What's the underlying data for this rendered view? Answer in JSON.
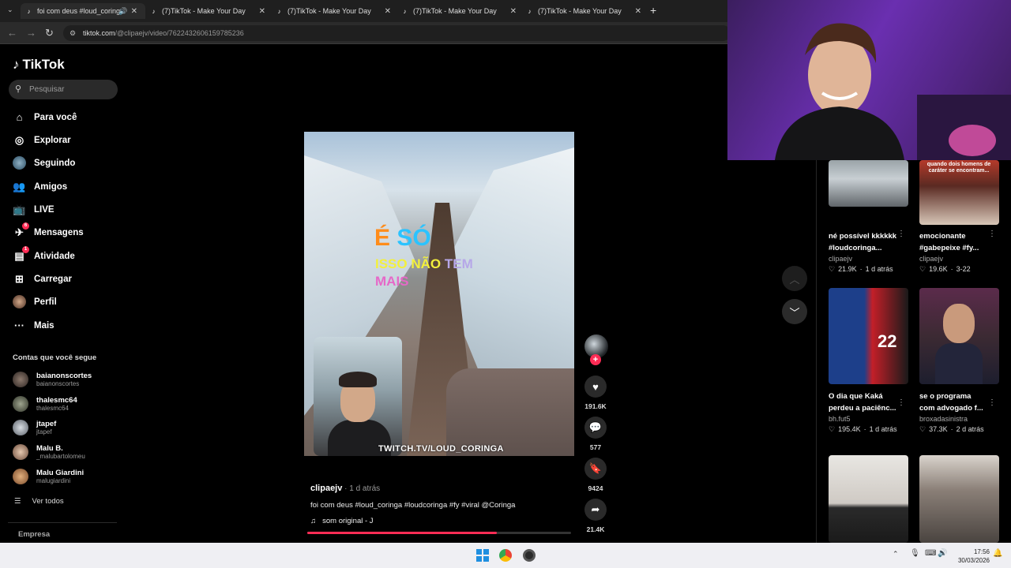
{
  "browser": {
    "tabs": [
      {
        "label": "foi com deus #loud_coringa",
        "active": true
      },
      {
        "label": "(7)TikTok - Make Your Day"
      },
      {
        "label": "(7)TikTok - Make Your Day"
      },
      {
        "label": "(7)TikTok - Make Your Day"
      },
      {
        "label": "(7)TikTok - Make Your Day"
      }
    ],
    "url_host": "tiktok.com",
    "url_path": "/@clipaejv/video/7622432606159785236"
  },
  "sidebar": {
    "logo": "TikTok",
    "search_placeholder": "Pesquisar",
    "nav": [
      {
        "label": "Para você",
        "icon": "home-icon"
      },
      {
        "label": "Explorar",
        "icon": "compass-icon"
      },
      {
        "label": "Seguindo",
        "icon": "following-icon"
      },
      {
        "label": "Amigos",
        "icon": "friends-icon"
      },
      {
        "label": "LIVE",
        "icon": "live-icon"
      },
      {
        "label": "Mensagens",
        "icon": "messages-icon",
        "badge": "6"
      },
      {
        "label": "Atividade",
        "icon": "activity-icon",
        "badge": "1"
      },
      {
        "label": "Carregar",
        "icon": "upload-icon"
      },
      {
        "label": "Perfil",
        "icon": "profile-icon"
      },
      {
        "label": "Mais",
        "icon": "more-icon"
      }
    ],
    "following_title": "Contas que você segue",
    "accounts": [
      {
        "name": "baianonscortes",
        "handle": "baianonscortes"
      },
      {
        "name": "thalesmc64",
        "handle": "thalesmc64"
      },
      {
        "name": "jtapef",
        "handle": "jtapef"
      },
      {
        "name": "Malu B.",
        "handle": "_malubartolomeu"
      },
      {
        "name": "Malu Giardini",
        "handle": "malugiardini"
      }
    ],
    "see_all": "Ver todos",
    "company": "Empresa"
  },
  "video": {
    "caption_line1_a": "É",
    "caption_line1_b": "SÓ",
    "caption_line2_a": "ISSO NÃO",
    "caption_line2_b": "TEM",
    "caption_line3": "MAIS",
    "watermark": "TWITCH.TV/LOUD_CORINGA",
    "author": "clipaejv",
    "time": " · 1 d atrás",
    "description": "foi com deus #loud_coringa #loudcoringa #fy #viral @Coringa",
    "sound": "som original - J",
    "progress": 0.72,
    "likes": "191.6K",
    "comments": "577",
    "saves": "9424",
    "shares": "21.4K"
  },
  "recommended": [
    {
      "title": "né possível kkkkkk\n#loudcoringa...",
      "author": "clipaejv",
      "likes": "21.9K",
      "age": "1 d atrás",
      "thumb_text": ""
    },
    {
      "title": "emocionante\n#gabepeixe #fy...",
      "author": "clipaejv",
      "likes": "19.6K",
      "age": "3-22",
      "thumb_text": "quando dois homens de caráter se encontram..."
    },
    {
      "title": "O dia que Kaká\nperdeu a paciênc...",
      "author": "bh.fut5",
      "likes": "195.4K",
      "age": "1 d atrás",
      "thumb_text": ""
    },
    {
      "title": "se o programa\ncom advogado f...",
      "author": "broxadasinistra",
      "likes": "37.3K",
      "age": "2 d atrás",
      "thumb_text": ""
    },
    {
      "title": "",
      "author": "",
      "likes": "",
      "age": "",
      "thumb_text": ""
    },
    {
      "title": "",
      "author": "",
      "likes": "",
      "age": "",
      "thumb_text": ""
    }
  ],
  "taskbar": {
    "time": "17:56",
    "date": "30/03/2026"
  },
  "colors": {
    "accent": "#fe2c55",
    "background": "#000000",
    "taskbar": "#efeff3"
  }
}
